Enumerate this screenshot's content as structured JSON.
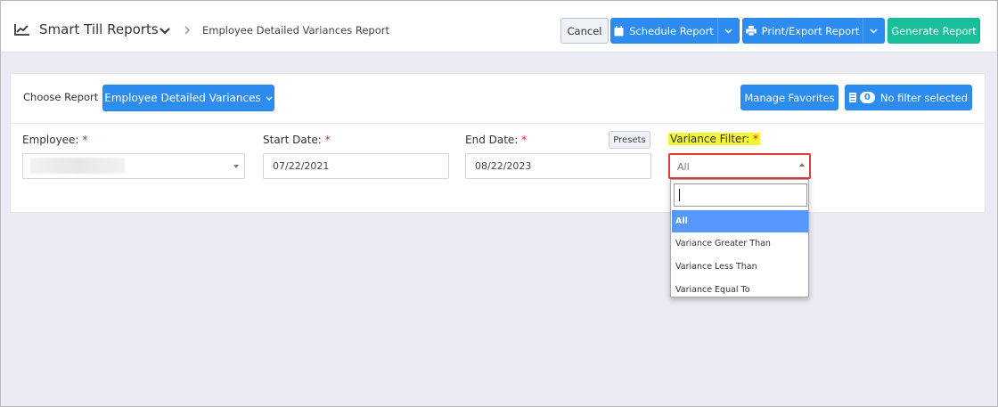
{
  "header": {
    "app_title": "Smart Till Reports",
    "breadcrumb": "Employee Detailed Variances Report",
    "cancel_label": "Cancel",
    "schedule_label": "Schedule Report",
    "print_label": "Print/Export Report",
    "generate_label": "Generate Report"
  },
  "toolbar": {
    "choose_label": "Choose Report",
    "report_button": "Employee Detailed Variances",
    "favorites_label": "Manage Favorites",
    "filter_count": "0",
    "filter_label": "No filter selected"
  },
  "form": {
    "employee_label": "Employee:",
    "start_label": "Start Date:",
    "start_value": "07/22/2021",
    "end_label": "End Date:",
    "end_value": "08/22/2023",
    "presets_label": "Presets",
    "variance_label": "Variance Filter:",
    "variance_value": "All",
    "required_mark": "*"
  },
  "dropdown": {
    "search_value": "",
    "options": [
      "All",
      "Variance Greater Than",
      "Variance Less Than",
      "Variance Equal To"
    ],
    "selected": "All"
  },
  "colors": {
    "primary": "#2d8cf0",
    "success": "#19be9b",
    "required": "#e8212b",
    "highlight": "#f3f538",
    "focus_border": "#e03a3a",
    "selected_option": "#5897fb"
  }
}
